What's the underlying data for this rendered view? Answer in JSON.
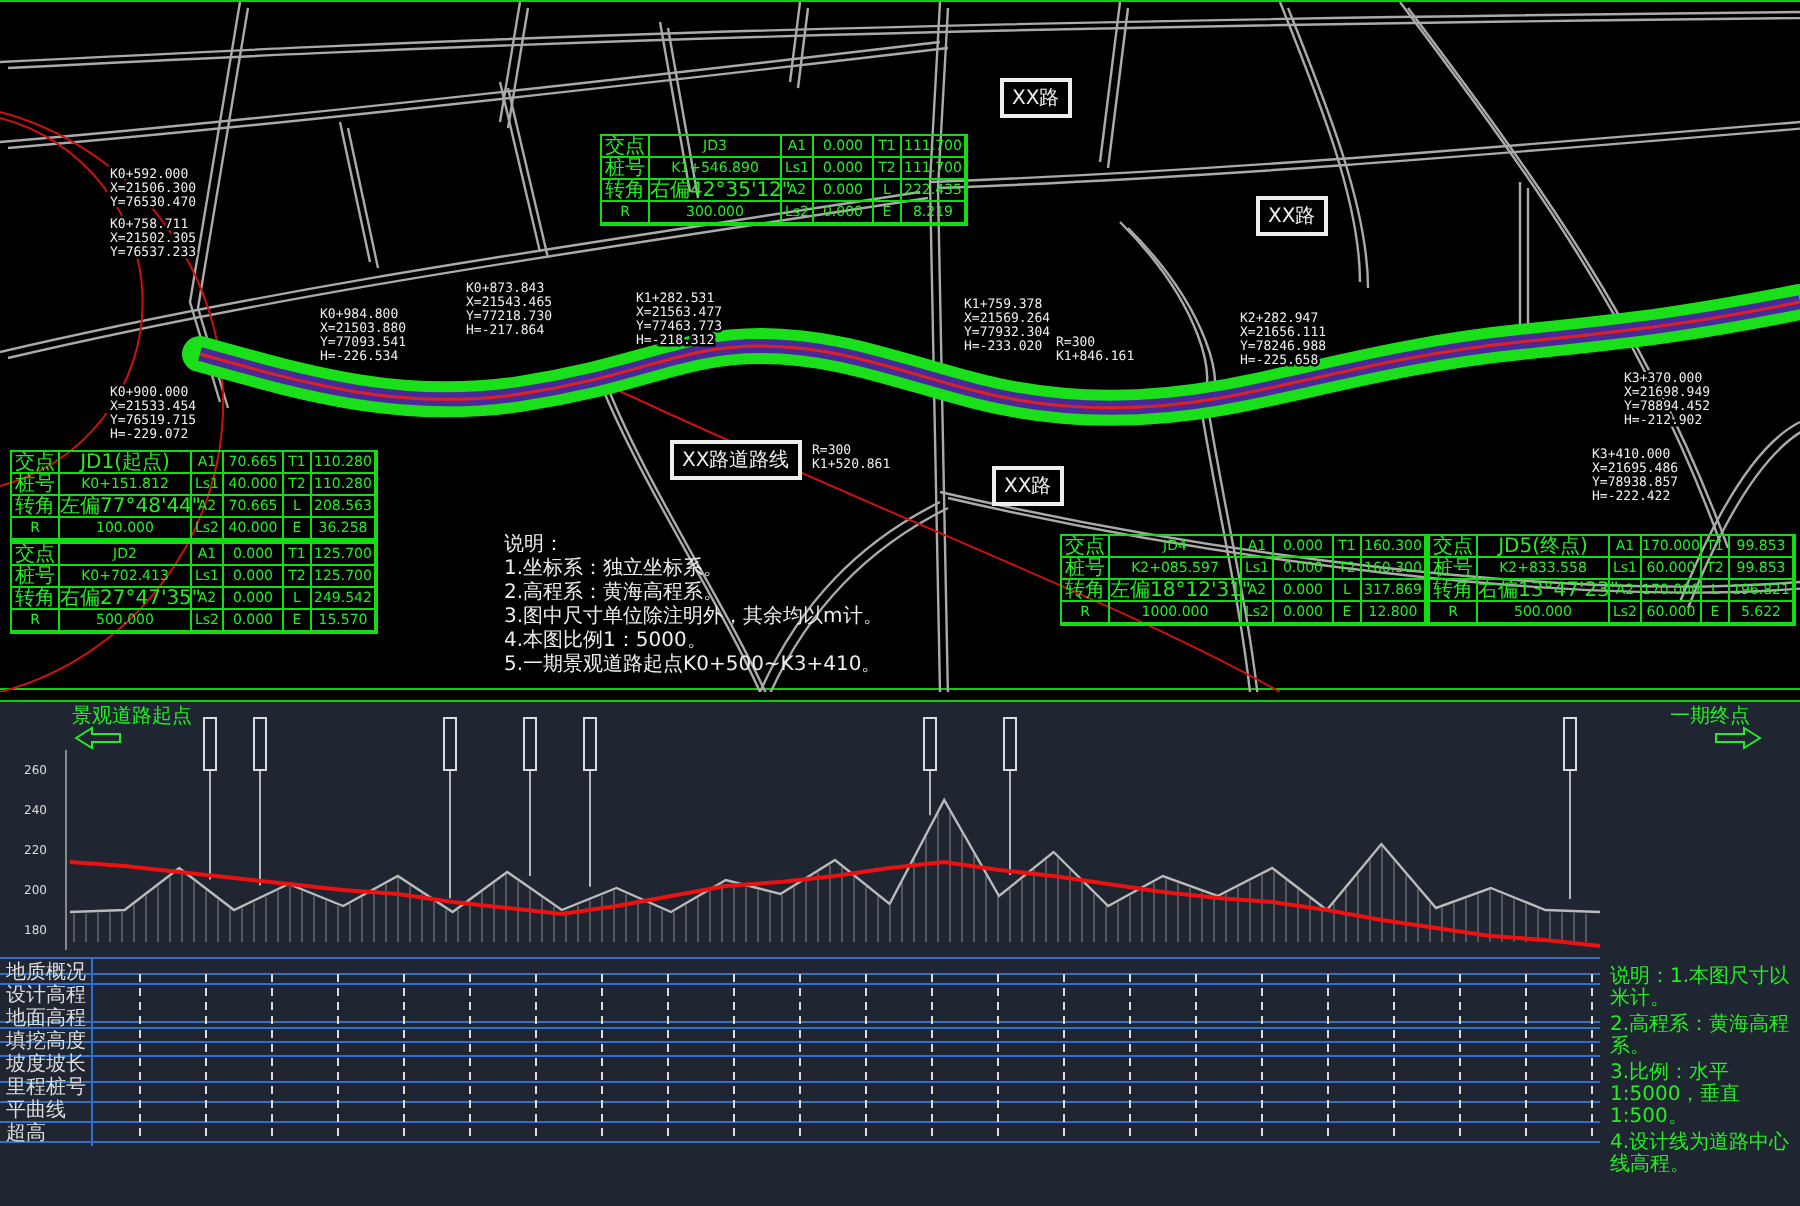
{
  "plan": {
    "road_tags": [
      "XX路",
      "XX路",
      "XX路"
    ],
    "start_tag": "XX路道路线",
    "curve_tables": [
      {
        "rows": [
          [
            "交点",
            "JD1(起点)",
            "A1",
            "70.665",
            "T1",
            "110.280"
          ],
          [
            "桩号",
            "K0+151.812",
            "Ls1",
            "40.000",
            "T2",
            "110.280"
          ],
          [
            "转角",
            "左偏77°48'44\"",
            "A2",
            "70.665",
            "L",
            "208.563"
          ],
          [
            "R",
            "100.000",
            "Ls2",
            "40.000",
            "E",
            "36.258"
          ]
        ]
      },
      {
        "rows": [
          [
            "交点",
            "JD2",
            "A1",
            "0.000",
            "T1",
            "125.700"
          ],
          [
            "桩号",
            "K0+702.413",
            "Ls1",
            "0.000",
            "T2",
            "125.700"
          ],
          [
            "转角",
            "右偏27°47'35\"",
            "A2",
            "0.000",
            "L",
            "249.542"
          ],
          [
            "R",
            "500.000",
            "Ls2",
            "0.000",
            "E",
            "15.570"
          ]
        ]
      },
      {
        "rows": [
          [
            "交点",
            "JD3",
            "A1",
            "0.000",
            "T1",
            "111.700"
          ],
          [
            "桩号",
            "K1+546.890",
            "Ls1",
            "0.000",
            "T2",
            "111.700"
          ],
          [
            "转角",
            "右偏42°35'12\"",
            "A2",
            "0.000",
            "L",
            "222.435"
          ],
          [
            "R",
            "300.000",
            "Ls2",
            "0.000",
            "E",
            "8.219"
          ]
        ]
      },
      {
        "rows": [
          [
            "交点",
            "JD4",
            "A1",
            "0.000",
            "T1",
            "160.300"
          ],
          [
            "桩号",
            "K2+085.597",
            "Ls1",
            "0.000",
            "T2",
            "160.300"
          ],
          [
            "转角",
            "左偏18°12'31\"",
            "A2",
            "0.000",
            "L",
            "317.869"
          ],
          [
            "R",
            "1000.000",
            "Ls2",
            "0.000",
            "E",
            "12.800"
          ]
        ]
      },
      {
        "rows": [
          [
            "交点",
            "JD5(终点)",
            "A1",
            "170.000",
            "T1",
            "99.853"
          ],
          [
            "桩号",
            "K2+833.558",
            "Ls1",
            "60.000",
            "T2",
            "99.853"
          ],
          [
            "转角",
            "右偏13°47'23\"",
            "A2",
            "170.000",
            "L",
            "196.821"
          ],
          [
            "R",
            "500.000",
            "Ls2",
            "60.000",
            "E",
            "5.622"
          ]
        ]
      }
    ],
    "station_notes": [
      [
        "K0+592.000",
        "X=21506.300",
        "Y=76530.470"
      ],
      [
        "K0+758.711",
        "X=21502.305",
        "Y=76537.233"
      ],
      [
        "K0+900.000",
        "X=21533.454",
        "Y=76519.715",
        "H=-229.072"
      ],
      [
        "K0+984.800",
        "X=21503.880",
        "Y=77093.541",
        "H=-226.534"
      ],
      [
        "K0+873.843",
        "X=21543.465",
        "Y=77218.730",
        "H=-217.864"
      ],
      [
        "K1+282.531",
        "X=21563.477",
        "Y=77463.773",
        "H=-218.312"
      ],
      [
        "K1+759.378",
        "X=21569.264",
        "Y=77932.304",
        "H=-233.020"
      ],
      [
        "R=300",
        "K1+846.161"
      ],
      [
        "R=300",
        "K1+520.861"
      ],
      [
        "K2+282.947",
        "X=21656.111",
        "Y=78246.988",
        "H=-225.658"
      ],
      [
        "K3+370.000",
        "X=21698.949",
        "Y=78894.452",
        "H=-212.902"
      ],
      [
        "K3+410.000",
        "X=21695.486",
        "Y=78938.857",
        "H=-222.422"
      ]
    ],
    "notes": [
      "说明：",
      "1.坐标系：独立坐标系。",
      "2.高程系：黄海高程系。",
      "3.图中尺寸单位除注明外，其余均以m计。",
      "4.本图比例1：5000。",
      "5.一期景观道路起点K0+500~K3+410。"
    ]
  },
  "profile": {
    "start_label": "景观道路起点",
    "end_label": "一期终点",
    "chart_data": {
      "type": "line",
      "ylim": [
        170,
        270
      ],
      "yticks": [
        260,
        240,
        220,
        200,
        180
      ],
      "series": [
        {
          "color": "#bbbbbb",
          "values": [
            189,
            190,
            211,
            190,
            203,
            192,
            207,
            189,
            209,
            190,
            201,
            189,
            205,
            198,
            215,
            193,
            245,
            197,
            219,
            192,
            207,
            197,
            211,
            190,
            223,
            191,
            201,
            190,
            189
          ]
        },
        {
          "color": "#ee1111",
          "values": [
            214,
            212,
            209,
            206,
            203,
            200,
            198,
            194,
            191,
            188,
            192,
            197,
            202,
            204,
            207,
            211,
            214,
            210,
            207,
            203,
            199,
            196,
            194,
            190,
            185,
            181,
            177,
            175,
            172
          ]
        }
      ]
    },
    "row_labels": [
      "地质概况",
      "设计高程",
      "地面高程",
      "填挖高度",
      "坡度坡长",
      "里程桩号",
      "平曲线",
      "超高"
    ],
    "notes": [
      "说明：1.本图尺寸以米计。",
      "2.高程系：黄海高程系。",
      "3.比例：水平1:5000，垂直1:500。",
      "4.设计线为道路中心线高程。"
    ]
  }
}
